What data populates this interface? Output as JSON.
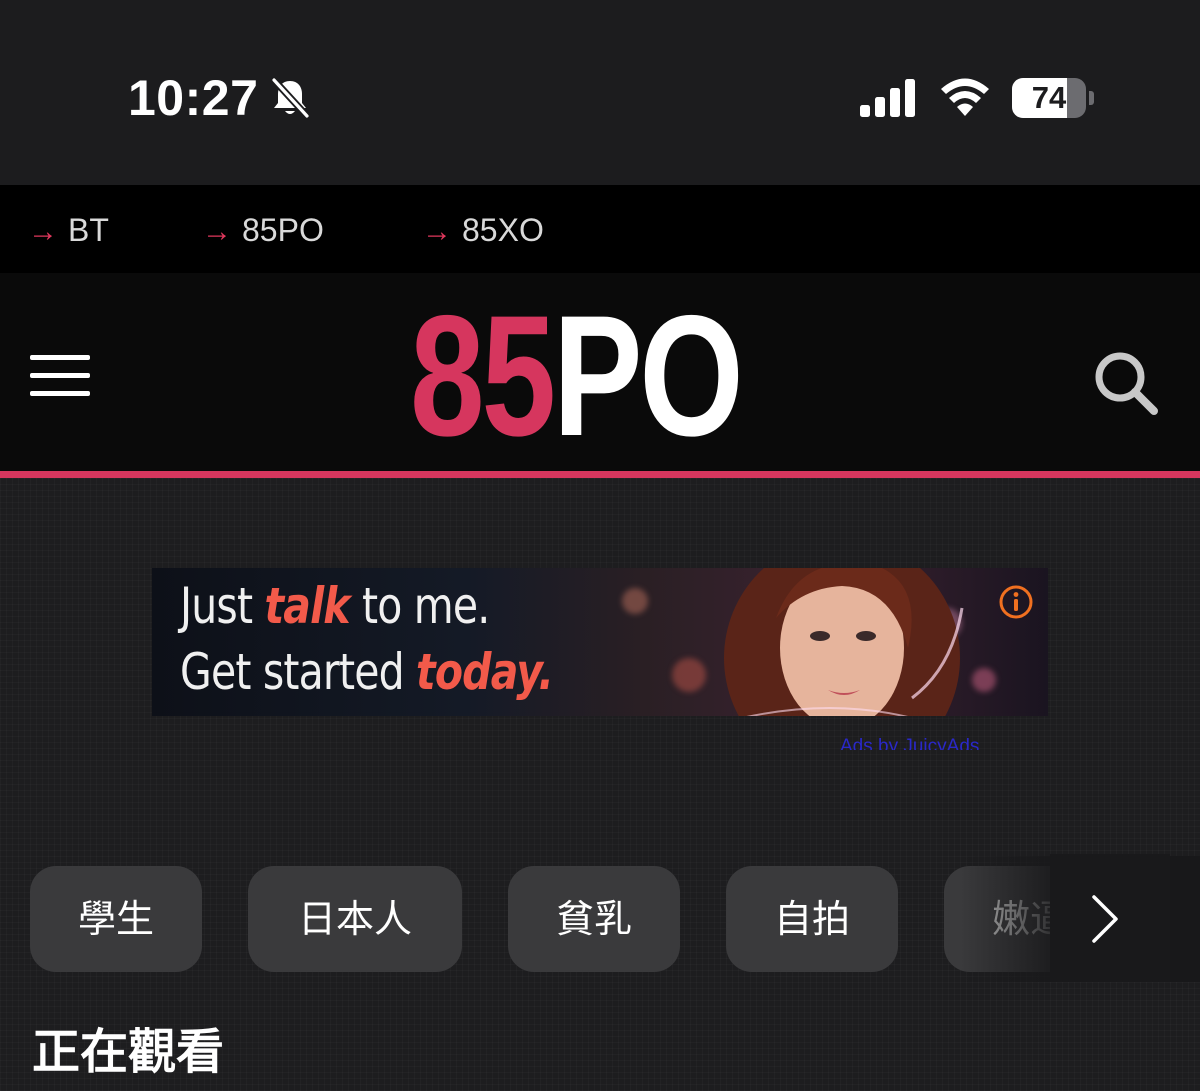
{
  "status_bar": {
    "time": "10:27",
    "battery_level": "74",
    "battery_fraction": 0.74,
    "icons": [
      "bell-slash-icon",
      "signal-icon",
      "wifi-icon",
      "battery-icon"
    ]
  },
  "top_links": [
    {
      "arrow": "→",
      "label": "BT"
    },
    {
      "arrow": "→",
      "label": "85PO"
    },
    {
      "arrow": "→",
      "label": "85XO"
    }
  ],
  "header": {
    "logo_number": "85",
    "logo_text": "PO",
    "menu_icon": "hamburger-menu-icon",
    "search_icon": "search-icon"
  },
  "ad": {
    "line1_start": "Just ",
    "line1_emphasis": "talk",
    "line1_end": " to me.",
    "line2_start": "Get started ",
    "line2_emphasis": "today.",
    "credit": "Ads by JuicyAds"
  },
  "categories": [
    {
      "label": "學生"
    },
    {
      "label": "日本人"
    },
    {
      "label": "貧乳"
    },
    {
      "label": "自拍"
    },
    {
      "label": "嫩逼"
    }
  ],
  "section": {
    "title": "正在觀看"
  },
  "colors": {
    "accent": "#d6365e",
    "background": "#1c1c1e",
    "chip": "#3a3a3c",
    "ad_emphasis": "#f25a4a"
  }
}
